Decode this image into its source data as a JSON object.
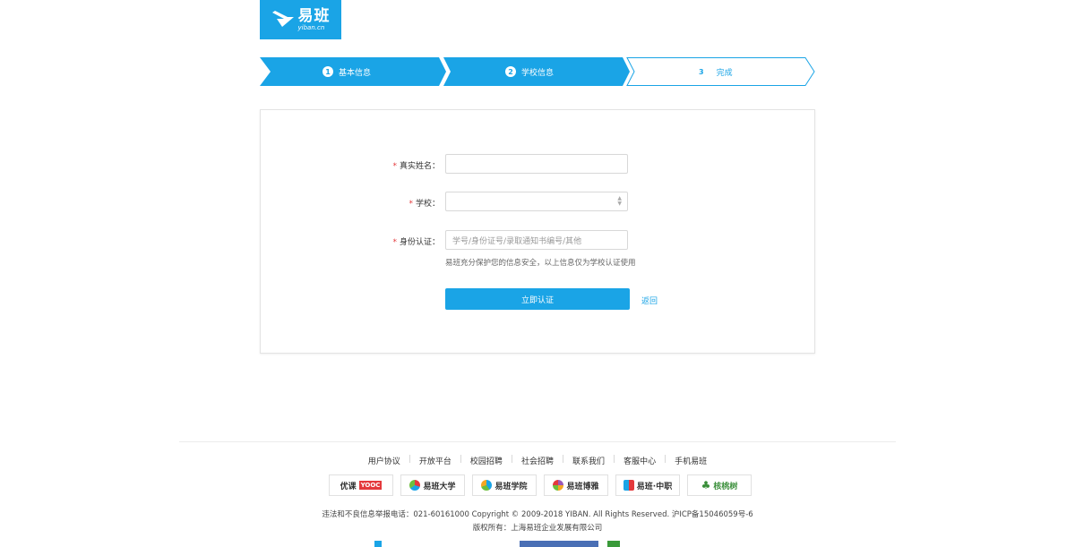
{
  "logo": {
    "cn": "易班",
    "en": "yiban.cn"
  },
  "steps": [
    {
      "num": "1",
      "label": "基本信息"
    },
    {
      "num": "2",
      "label": "学校信息"
    },
    {
      "num": "3",
      "label": "完成"
    }
  ],
  "colors": {
    "accent": "#1aa4e6",
    "required": "#e4393c",
    "border": "#d8d8d8"
  },
  "form": {
    "required_mark": "*",
    "name": {
      "label": "真实姓名：",
      "value": ""
    },
    "school": {
      "label": "学校：",
      "value": ""
    },
    "identity": {
      "label": "身份认证：",
      "placeholder": "学号/身份证号/录取通知书编号/其他",
      "hint": "易班充分保护您的信息安全，以上信息仅为学校认证使用"
    },
    "submit_label": "立即认证",
    "back_label": "返回"
  },
  "footer": {
    "links": [
      "用户协议",
      "开放平台",
      "校园招聘",
      "社会招聘",
      "联系我们",
      "客服中心",
      "手机易班"
    ],
    "partners": [
      {
        "name": "优课",
        "badge": "YOOC",
        "icon": "yooc-logo"
      },
      {
        "name": "易班大学",
        "icon": "yiban-university-logo"
      },
      {
        "name": "易班学院",
        "icon": "yiban-college-logo"
      },
      {
        "name": "易班博雅",
        "icon": "yiban-boya-logo"
      },
      {
        "name": "易班·中职",
        "icon": "yiban-vocational-logo"
      },
      {
        "name": "核桃树",
        "icon": "hetaoshu-logo"
      }
    ],
    "copyright": "违法和不良信息举报电话：021-60161000 Copyright © 2009-2018 YIBAN. All Rights Reserved. 沪ICP备15046059号-6",
    "rights": "版权所有：上海易班企业发展有限公司"
  }
}
